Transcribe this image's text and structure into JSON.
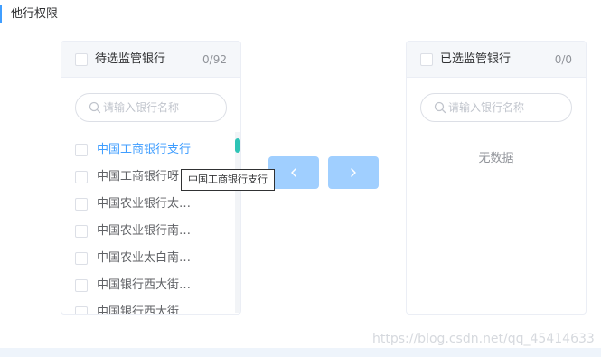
{
  "section_title": "他行权限",
  "source_panel": {
    "title": "待选监管银行",
    "count": "0/92",
    "search_placeholder": "请输入银行名称",
    "items": [
      "中国工商银行支行",
      "中国工商银行呀",
      "中国农业银行太…",
      "中国农业银行南…",
      "中国农业太白南…",
      "中国银行西大街…",
      "中国银行西大街"
    ]
  },
  "target_panel": {
    "title": "已选监管银行",
    "count": "0/0",
    "search_placeholder": "请输入银行名称",
    "empty_text": "无数据"
  },
  "tooltip": "中国工商银行支行",
  "watermark": "https://blog.csdn.net/qq_45414633",
  "colors": {
    "accent": "#409eff",
    "button_disabled": "#a0cfff",
    "scroll_thumb": "#2ec4b6",
    "header_bg": "#f5f7fa"
  }
}
